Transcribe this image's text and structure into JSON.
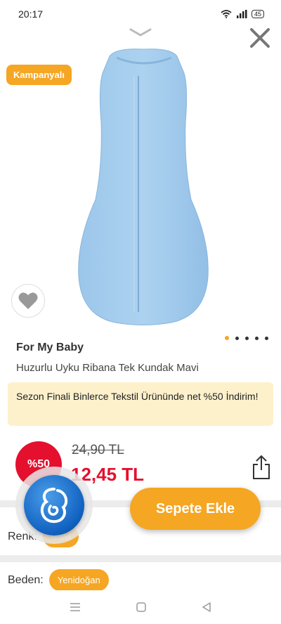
{
  "status_bar": {
    "time": "20:17",
    "battery": "45"
  },
  "badge": {
    "label": "Kampanyalı"
  },
  "product": {
    "brand": "For My Baby",
    "name": "Huzurlu Uyku Ribana Tek Kundak Mavi",
    "image_color": "#a9cfee"
  },
  "carousel": {
    "count": 5,
    "active_index": 0
  },
  "promo": {
    "text": "Sezon Finali Binlerce Tekstil Ürününde net %50 İndirim!"
  },
  "pricing": {
    "discount": "%50",
    "old_price": "24,90 TL",
    "new_price": "12,45 TL"
  },
  "actions": {
    "add_to_cart": "Sepete Ekle"
  },
  "options": {
    "color_label": "Renk:",
    "color_value": "Mavi",
    "size_label": "Beden:",
    "size_value": "Yenidoğan"
  },
  "colors": {
    "accent": "#f5a623",
    "sale": "#e4102e",
    "promo_bg": "#fdf1cc"
  }
}
